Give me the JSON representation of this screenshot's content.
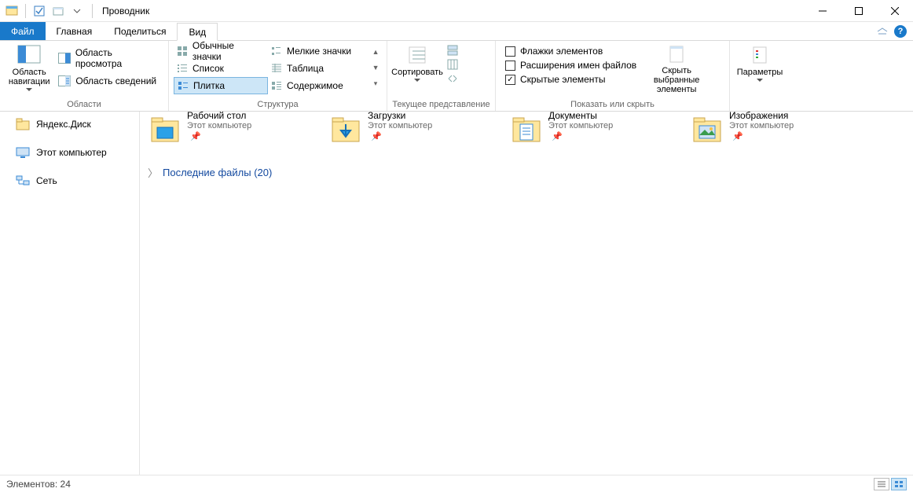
{
  "window": {
    "title": "Проводник"
  },
  "tabs": {
    "file": "Файл",
    "home": "Главная",
    "share": "Поделиться",
    "view": "Вид"
  },
  "ribbon": {
    "panes": {
      "nav_pane": "Область навигации",
      "preview_pane": "Область просмотра",
      "details_pane": "Область сведений",
      "group_label": "Области"
    },
    "layout": {
      "opts": {
        "regular": "Обычные значки",
        "small": "Мелкие значки",
        "list": "Список",
        "table": "Таблица",
        "tiles": "Плитка",
        "content": "Содержимое"
      },
      "group_label": "Структура"
    },
    "currentview": {
      "sort": "Сортировать",
      "group_label": "Текущее представление"
    },
    "showhide": {
      "checkboxes": "Флажки элементов",
      "extensions": "Расширения имен файлов",
      "hidden": "Скрытые элементы",
      "hidden_checked": true,
      "hide_selected_top": "Скрыть выбранные",
      "hide_selected_bottom": "элементы",
      "group_label": "Показать или скрыть"
    },
    "options": {
      "label": "Параметры"
    }
  },
  "sidebar": {
    "items": [
      {
        "label": "Яндекс.Диск",
        "icon": "folder"
      },
      {
        "label": "Этот компьютер",
        "icon": "pc"
      },
      {
        "label": "Сеть",
        "icon": "network"
      }
    ]
  },
  "tiles": [
    {
      "name": "Рабочий стол",
      "sub": "Этот компьютер",
      "icon": "desktop"
    },
    {
      "name": "Загрузки",
      "sub": "Этот компьютер",
      "icon": "downloads"
    },
    {
      "name": "Документы",
      "sub": "Этот компьютер",
      "icon": "documents"
    },
    {
      "name": "Изображения",
      "sub": "Этот компьютер",
      "icon": "pictures"
    }
  ],
  "section": {
    "recent": "Последние файлы (20)"
  },
  "status": {
    "count_label": "Элементов:",
    "count": "24"
  }
}
